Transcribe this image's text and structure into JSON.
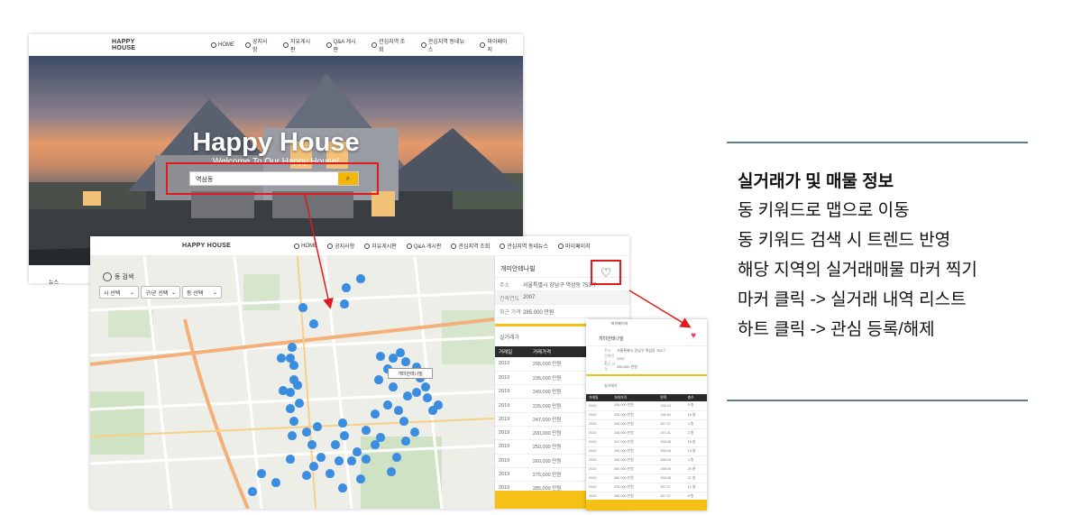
{
  "home": {
    "brand": "HAPPY HOUSE",
    "nav": [
      "HOME",
      "공지사항",
      "자유게시판",
      "Q&A 게시판",
      "관심지역 조회",
      "관심지역 동네뉴스",
      "마이페이지"
    ],
    "hero_title": "Happy House",
    "hero_subtitle": "Welcome To Our Happy House!",
    "search_value": "역삼동",
    "search_button_icon": "search-icon",
    "side_label": "뉴스"
  },
  "map_page": {
    "brand": "HAPPY HOUSE",
    "nav": [
      "HOME",
      "공지사항",
      "자유게시판",
      "Q&A 게시판",
      "관심지역 조회",
      "관심지역 동네뉴스",
      "마이페이지"
    ],
    "search_label": "동 검색",
    "selects": [
      "시 선택",
      "구/군 선택",
      "동 선택"
    ],
    "map_popup": "개미안테나빌",
    "panel": {
      "title": "개미안테나빌",
      "info": [
        {
          "key": "주소",
          "value": "서울특별시 강남구 역삼동 753-7"
        },
        {
          "key": "건축연도",
          "value": "2007"
        },
        {
          "key": "최근 가격",
          "value": "285,000 만원"
        }
      ],
      "deals_label": "실거래가",
      "table_headers": [
        "거래일",
        "거래가격",
        "면적"
      ],
      "rows": [
        [
          "2019",
          "205,000 만원",
          "136.24"
        ],
        [
          "2019",
          "235,000 만원",
          "136.54"
        ],
        [
          "2019",
          "249,000 만원",
          "157.37"
        ],
        [
          "2019",
          "235,000 만원",
          "157.37"
        ],
        [
          "2019",
          "247,000 만원",
          "158.08"
        ],
        [
          "2019",
          "200,000 만원",
          "158.08"
        ],
        [
          "2019",
          "250,000 만원",
          "158.08"
        ],
        [
          "2019",
          "260,000 만원",
          "158.08"
        ],
        [
          "2019",
          "275,000 만원",
          "157.37"
        ],
        [
          "2019",
          "285,000 만원",
          "157.37"
        ]
      ]
    }
  },
  "favorite_view": {
    "top_text": "마이페이지",
    "title": "개미안테나빌",
    "info": [
      {
        "key": "주소",
        "value": "서울특별시 강남구 역삼동 753-7"
      },
      {
        "key": "건축연도",
        "value": "2007"
      },
      {
        "key": "최근 가격",
        "value": "285,000 만원"
      }
    ],
    "deals_label": "실거래가",
    "table_headers": [
      "거래일",
      "거래가격",
      "면적",
      "층수"
    ],
    "rows": [
      [
        "2019",
        "205,000 만원",
        "136.24",
        "5 층"
      ],
      [
        "2019",
        "235,000 만원",
        "136.54",
        "18 층"
      ],
      [
        "2019",
        "249,000 만원",
        "157.37",
        "3 층"
      ],
      [
        "2019",
        "235,000 만원",
        "157.41",
        "2 층"
      ],
      [
        "2019",
        "247,000 만원",
        "158.08",
        "16 층"
      ],
      [
        "2019",
        "200,000 만원",
        "158.08",
        "19 층"
      ],
      [
        "2019",
        "250,000 만원",
        "158.08",
        "3 층"
      ],
      [
        "2019",
        "260,000 만원",
        "158.08",
        "20 층"
      ],
      [
        "2019",
        "260,000 만원",
        "158.08",
        "21 층"
      ],
      [
        "2019",
        "275,000 만원",
        "157.37",
        "12 층"
      ],
      [
        "2019",
        "285,000 만원",
        "157.37",
        "8 층"
      ]
    ]
  },
  "description": {
    "heading": "실거래가 및 매물 정보",
    "lines": [
      "동 키워드로 맵으로 이동",
      "동 키워드 검색 시 트렌드 반영",
      "해당 지역의 실거래매물 마커 찍기",
      "마커 클릭 -> 실거래 내역 리스트",
      "하트 클릭 -> 관심 등록/해제"
    ]
  },
  "colors": {
    "accent_yellow": "#f5c116",
    "highlight_red": "#e01b1b",
    "divider": "#5f7f86",
    "marker_blue": "#3b8de0",
    "heart_pink": "#ec3a6e"
  }
}
